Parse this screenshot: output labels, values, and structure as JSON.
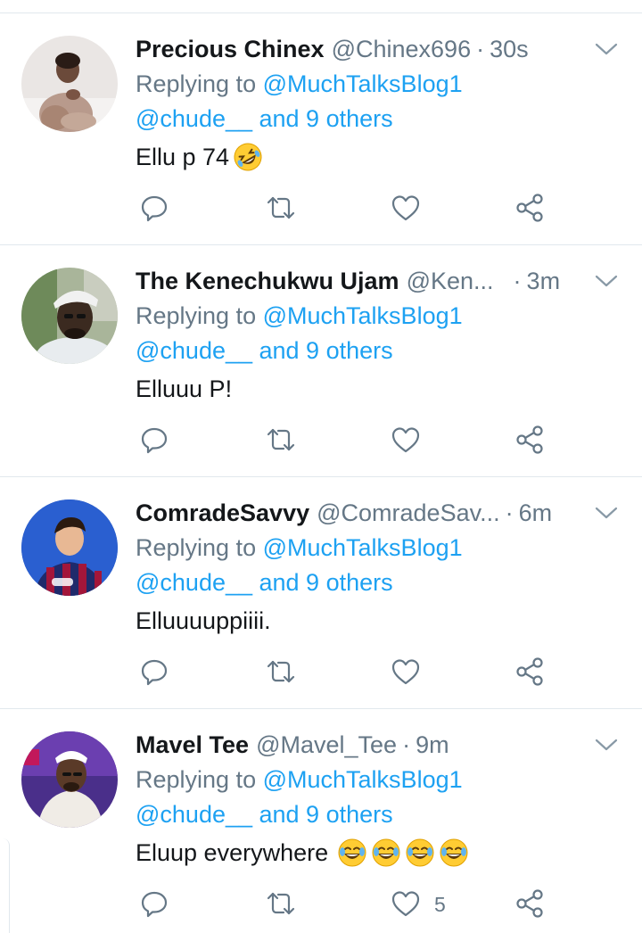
{
  "colors": {
    "link": "#1da1f2",
    "muted": "#657786",
    "divider": "#e1e8ed"
  },
  "tweets": [
    {
      "name": "Precious Chinex",
      "handle": "@Chinex696",
      "separator": "·",
      "time": "30s",
      "reply_prefix": "Replying to",
      "reply_to": "@MuchTalksBlog1",
      "reply_others": "@chude__ and 9 others",
      "body": "Ellu p 74",
      "emoji": [
        "rolling-on-floor-laughing"
      ],
      "like_count": ""
    },
    {
      "name": "The Kenechukwu Ujam",
      "handle": "@Ken...",
      "separator": "·",
      "time": "3m",
      "reply_prefix": "Replying to",
      "reply_to": "@MuchTalksBlog1",
      "reply_others": "@chude__ and 9 others",
      "body": "Elluuu P!",
      "emoji": [],
      "like_count": ""
    },
    {
      "name": "ComradeSavvy",
      "handle": "@ComradeSav...",
      "separator": "·",
      "time": "6m",
      "reply_prefix": "Replying to",
      "reply_to": "@MuchTalksBlog1",
      "reply_others": "@chude__ and 9 others",
      "body": "Elluuuuppiiii.",
      "emoji": [],
      "like_count": ""
    },
    {
      "name": "Mavel Tee",
      "handle": "@Mavel_Tee",
      "separator": "·",
      "time": "9m",
      "reply_prefix": "Replying to",
      "reply_to": "@MuchTalksBlog1",
      "reply_others": "@chude__ and 9 others",
      "body": "Eluup everywhere",
      "emoji": [
        "tears-of-joy",
        "tears-of-joy",
        "tears-of-joy",
        "tears-of-joy"
      ],
      "like_count": "5"
    }
  ]
}
